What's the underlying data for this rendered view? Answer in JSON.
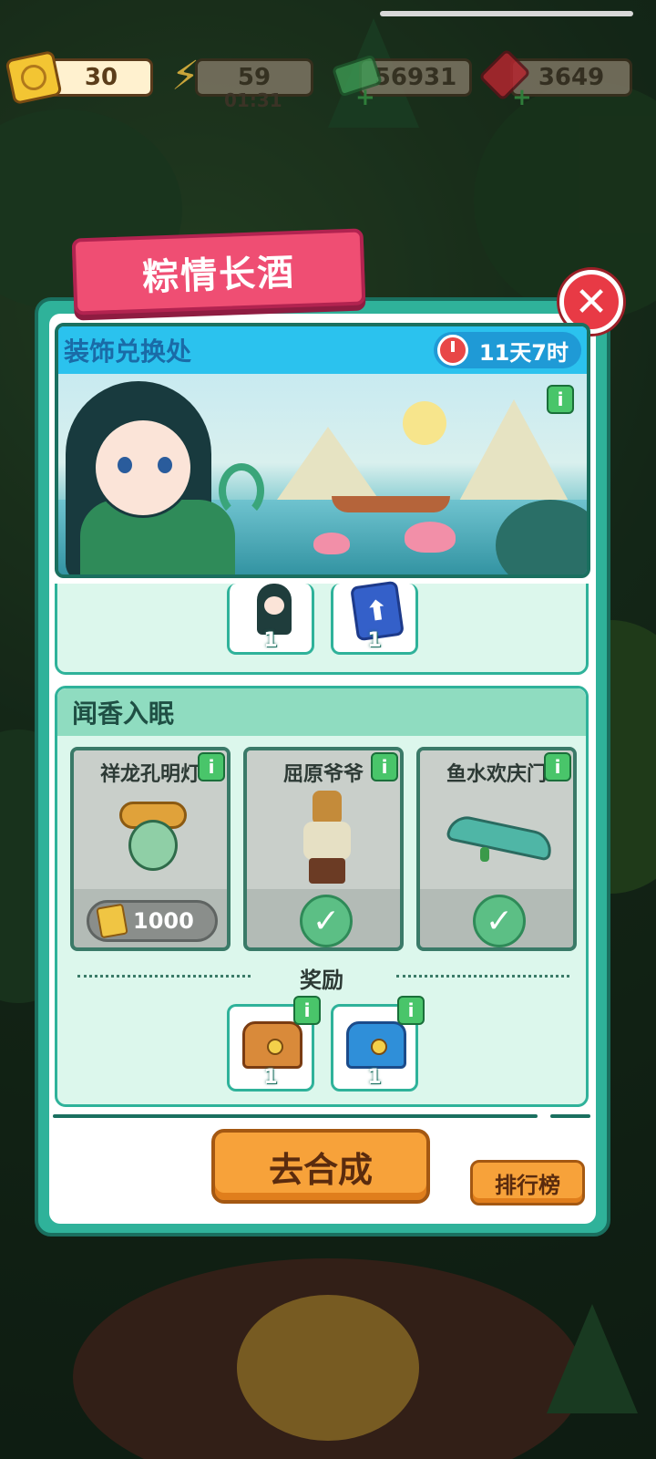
{
  "resources": {
    "tickets": "30",
    "energy": "59",
    "energy_timer": "01:31",
    "cash": "56931",
    "gems": "3649"
  },
  "event": {
    "title": "粽情长酒",
    "hero_title": "装饰兑换处",
    "hero_timer": "11天7时",
    "info_label": "i"
  },
  "section1": {
    "items": [
      {
        "count": "1"
      },
      {
        "count": "1"
      }
    ]
  },
  "section2": {
    "title": "闻香入眠",
    "items": [
      {
        "name": "祥龙孔明灯",
        "cost": "1000",
        "status": "locked"
      },
      {
        "name": "屈原爷爷",
        "status": "claimed"
      },
      {
        "name": "鱼水欢庆门",
        "status": "claimed"
      }
    ],
    "reward_label": "奖励",
    "rewards": [
      {
        "count": "1"
      },
      {
        "count": "1"
      }
    ]
  },
  "buttons": {
    "go": "去合成",
    "rank": "排行榜"
  },
  "icons": {
    "close": "close-icon",
    "check": "check-icon",
    "info": "info-icon"
  },
  "colors": {
    "panel": "#2fb29a",
    "title_banner": "#ef4e73",
    "button": "#f7a23a",
    "close": "#e83a45"
  }
}
